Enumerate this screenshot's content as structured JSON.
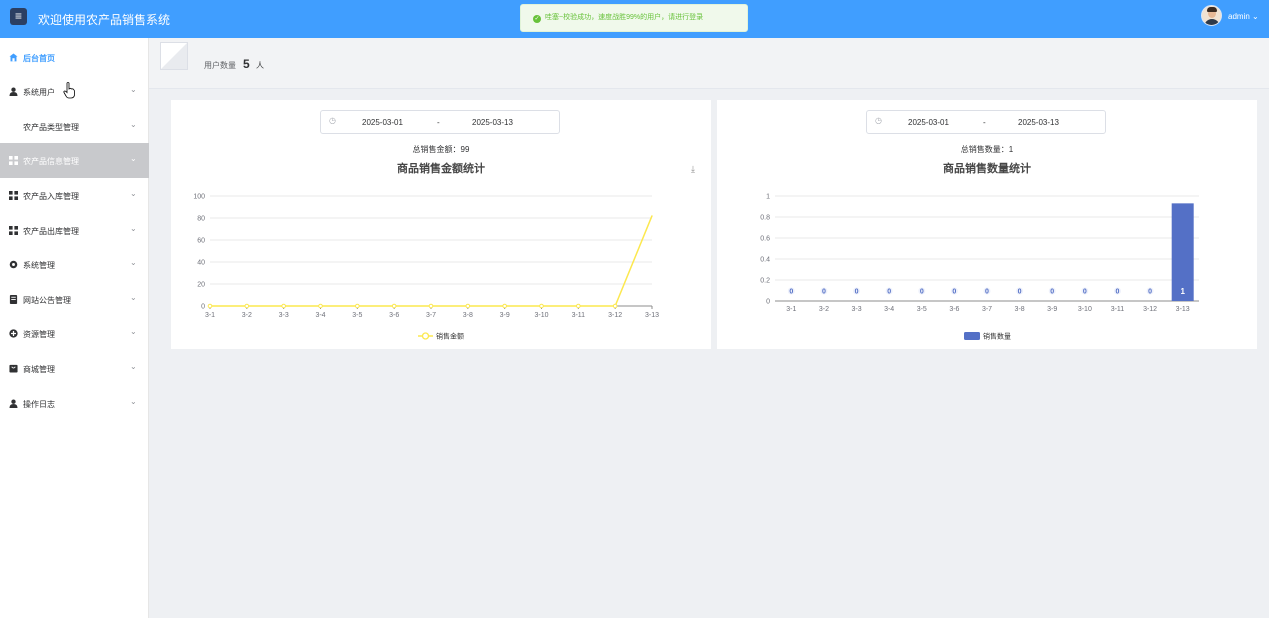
{
  "header": {
    "menu_icon": "hamburger-icon",
    "title": "欢迎使用农产品销售系统",
    "toast_message": "哇塞~校验成功，速度战胜99%的用户，请进行登录",
    "user_name": "admin"
  },
  "sidebar": {
    "items": [
      {
        "label": "后台首页",
        "icon": "home-icon",
        "active": true
      },
      {
        "label": "系统用户",
        "icon": "user-icon"
      },
      {
        "label": "农产品类型管理",
        "icon": ""
      },
      {
        "label": "农产品信息管理",
        "icon": "grid-icon"
      },
      {
        "label": "农产品入库管理",
        "icon": "grid-icon"
      },
      {
        "label": "农产品出库管理",
        "icon": "grid-icon"
      },
      {
        "label": "系统管理",
        "icon": "gear-icon"
      },
      {
        "label": "网站公告管理",
        "icon": "document-icon"
      },
      {
        "label": "资源管理",
        "icon": "plus-circle-icon"
      },
      {
        "label": "商城管理",
        "icon": "shop-icon"
      },
      {
        "label": "操作日志",
        "icon": "user-icon"
      }
    ]
  },
  "stats": {
    "user_count_label": "用户数量",
    "user_count_value": "5",
    "user_count_unit": "人"
  },
  "charts": {
    "amount": {
      "start_date": "2025-03-01",
      "separator": "-",
      "end_date": "2025-03-13",
      "total_text": "总销售金额：99"
    },
    "quantity": {
      "start_date": "2025-03-01",
      "separator": "-",
      "end_date": "2025-03-13",
      "total_text": "总销售数量：1"
    }
  },
  "chart_data": [
    {
      "type": "line",
      "title": "商品销售金额统计",
      "categories": [
        "3-1",
        "3-2",
        "3-3",
        "3-4",
        "3-5",
        "3-6",
        "3-7",
        "3-8",
        "3-9",
        "3-10",
        "3-11",
        "3-12",
        "3-13"
      ],
      "yticks": [
        0,
        20,
        40,
        60,
        80,
        100
      ],
      "ylim": [
        0,
        100
      ],
      "series": [
        {
          "name": "销售金额",
          "values": [
            0,
            0,
            0,
            0,
            0,
            0,
            0,
            0,
            0,
            0,
            0,
            0,
            82
          ]
        }
      ],
      "color": "#fce84f",
      "grid": true,
      "legend": "bottom"
    },
    {
      "type": "bar",
      "title": "商品销售数量统计",
      "categories": [
        "3-1",
        "3-2",
        "3-3",
        "3-4",
        "3-5",
        "3-6",
        "3-7",
        "3-8",
        "3-9",
        "3-10",
        "3-11",
        "3-12",
        "3-13"
      ],
      "yticks": [
        "0",
        "0.2",
        "0.4",
        "0.6",
        "0.8",
        "1"
      ],
      "ylim": [
        0,
        1
      ],
      "series": [
        {
          "name": "销售数量",
          "values": [
            0,
            0,
            0,
            0,
            0,
            0,
            0,
            0,
            0,
            0,
            0,
            0,
            0.93
          ]
        }
      ],
      "data_labels": [
        "0",
        "0",
        "0",
        "0",
        "0",
        "0",
        "0",
        "0",
        "0",
        "0",
        "0",
        "0",
        "1"
      ],
      "color": "#5470c6",
      "grid": true,
      "legend": "bottom"
    }
  ]
}
